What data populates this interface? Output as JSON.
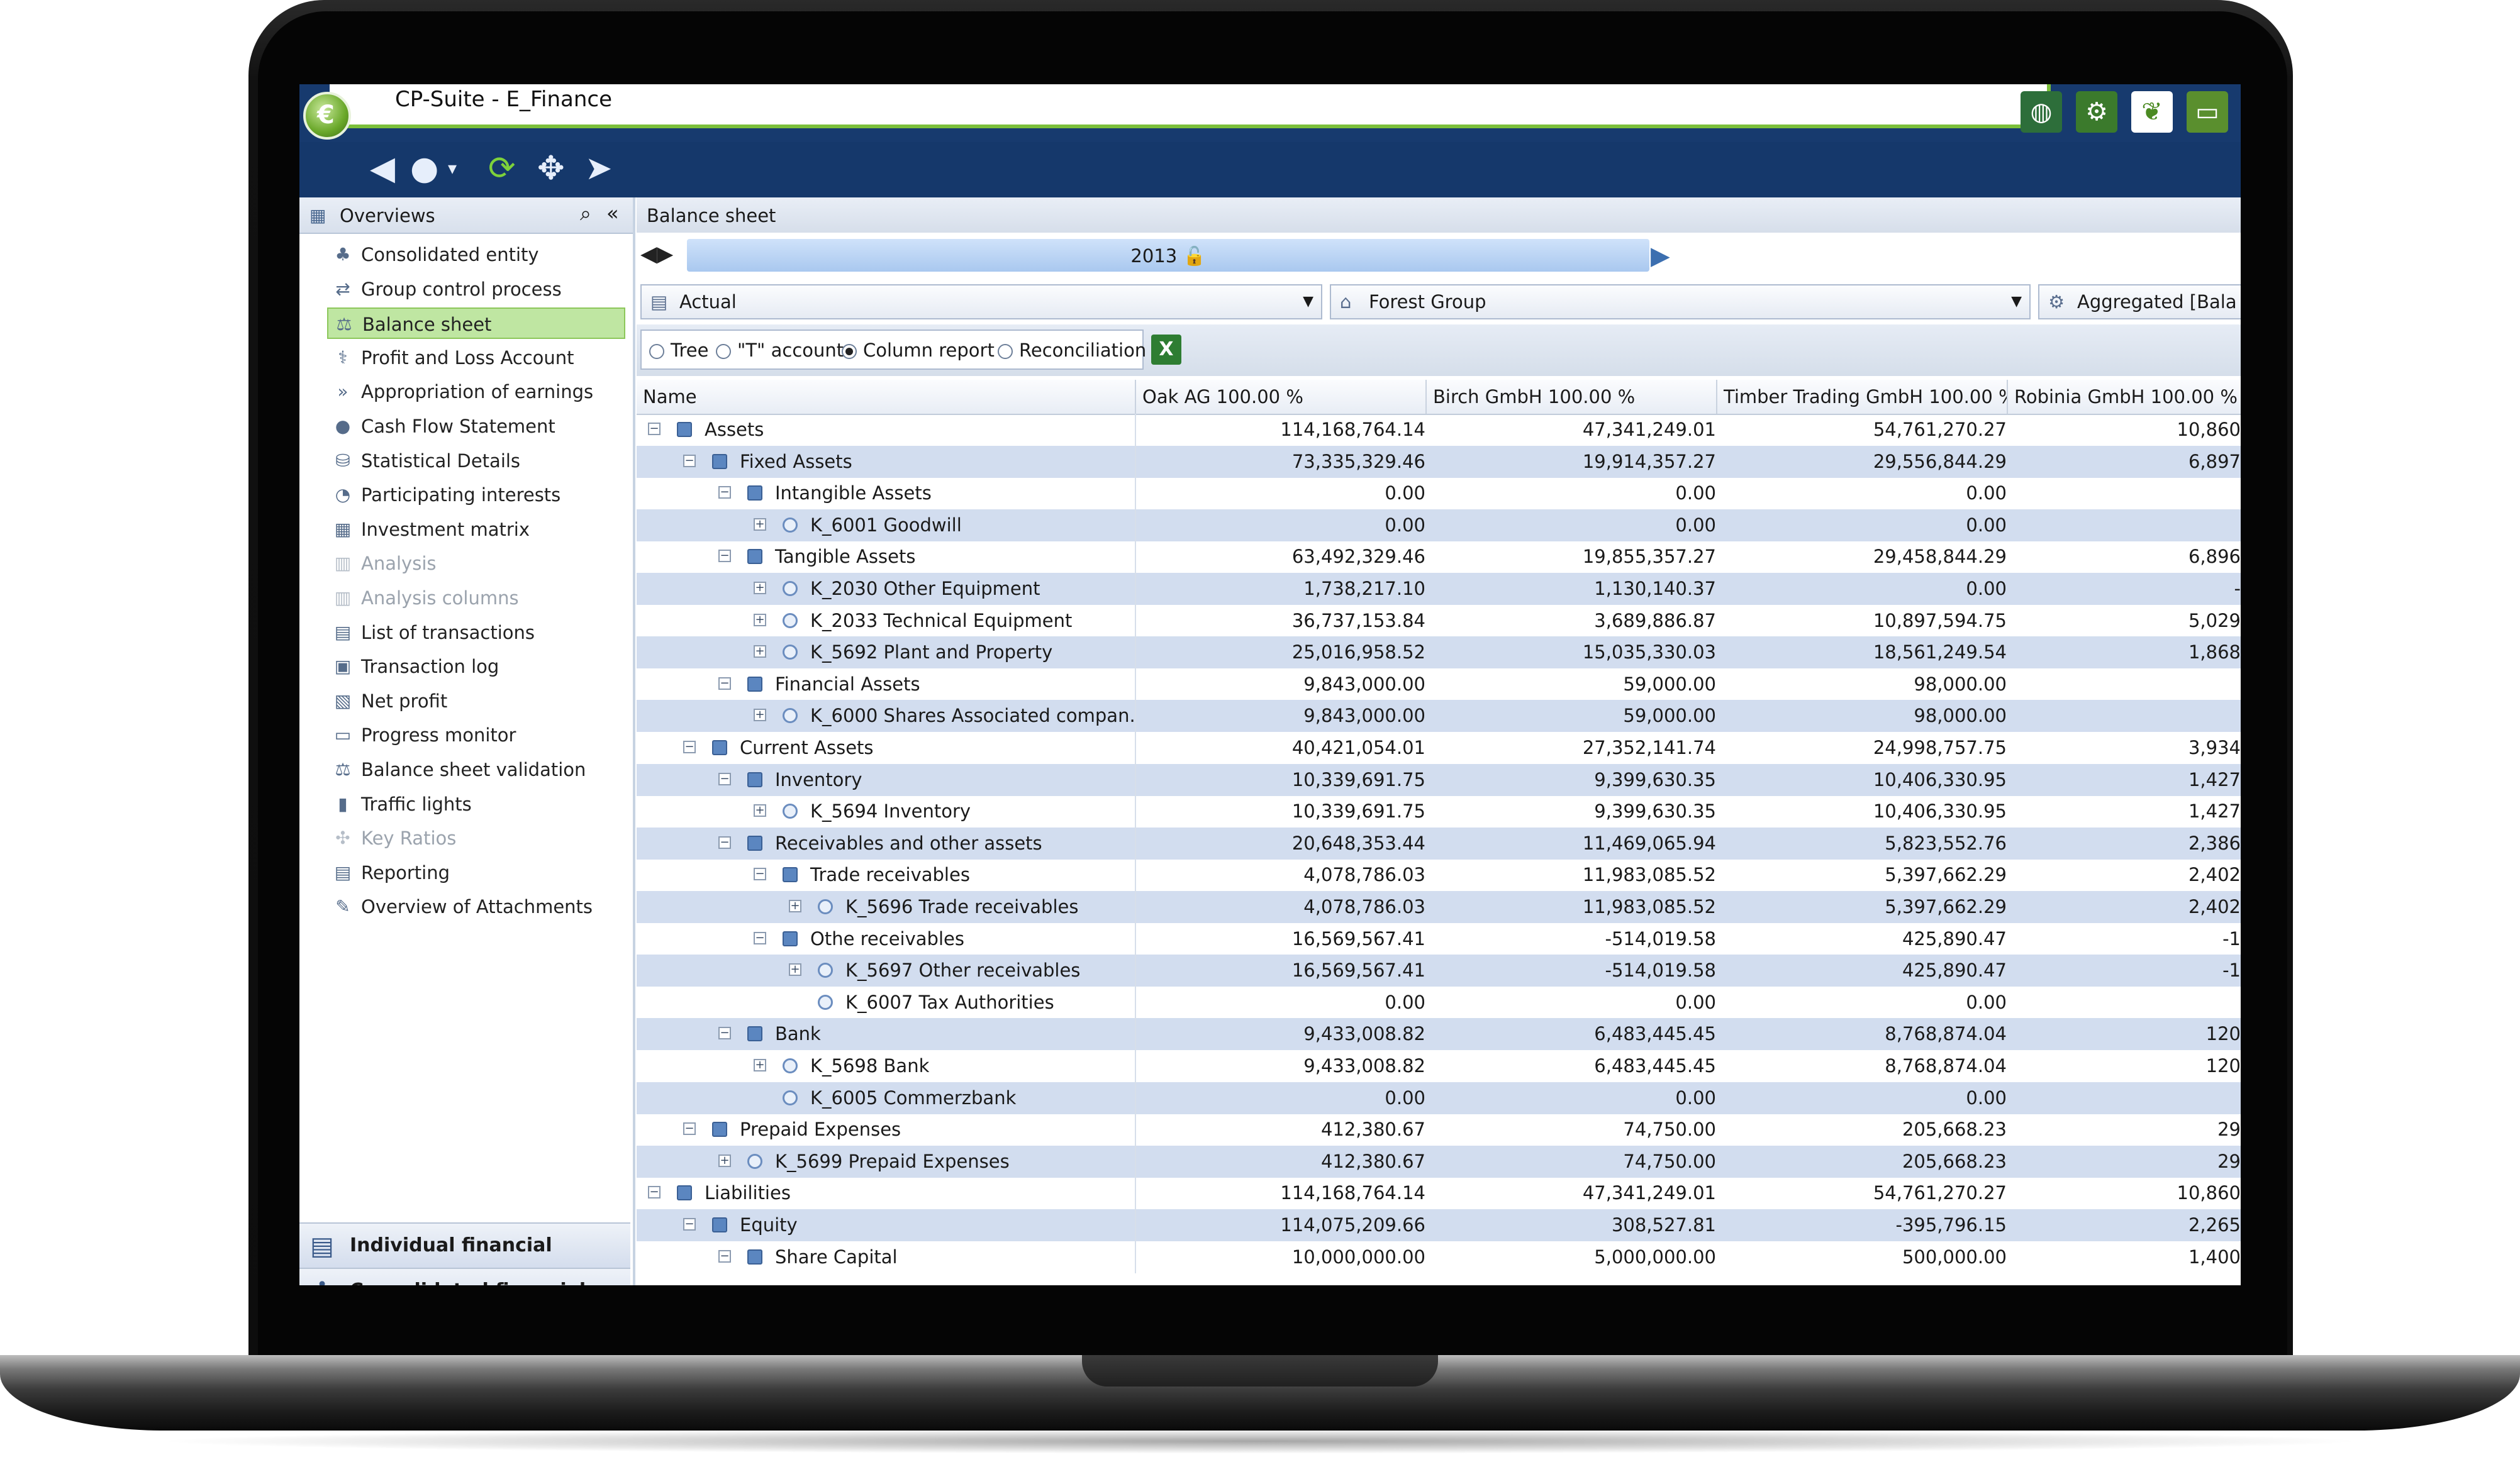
{
  "window": {
    "title": "CP-Suite - E_Finance"
  },
  "toolbar": {
    "icons": [
      "back-arrow-icon",
      "forward-arrow-icon",
      "refresh-icon",
      "move-icon",
      "navigate-icon"
    ]
  },
  "topbar_icons": [
    "globe-icon",
    "gears-icon",
    "leaf-icon",
    "money-icon"
  ],
  "overviews": {
    "title": "Overviews",
    "items": [
      {
        "label": "Consolidated entity",
        "icon": "entity-icon",
        "state": "normal"
      },
      {
        "label": "Group control process",
        "icon": "process-icon",
        "state": "normal"
      },
      {
        "label": "Balance sheet",
        "icon": "scale-icon",
        "state": "selected"
      },
      {
        "label": "Profit and Loss Account",
        "icon": "pl-icon",
        "state": "normal"
      },
      {
        "label": "Appropriation of earnings",
        "icon": "appropriation-icon",
        "state": "normal"
      },
      {
        "label": "Cash Flow Statement",
        "icon": "cashflow-icon",
        "state": "normal"
      },
      {
        "label": "Statistical Details",
        "icon": "statistics-icon",
        "state": "normal"
      },
      {
        "label": "Participating interests",
        "icon": "interests-icon",
        "state": "normal"
      },
      {
        "label": "Investment matrix",
        "icon": "matrix-icon",
        "state": "normal"
      },
      {
        "label": "Analysis",
        "icon": "analysis-icon",
        "state": "disabled"
      },
      {
        "label": "Analysis columns",
        "icon": "analysis-columns-icon",
        "state": "disabled"
      },
      {
        "label": "List of transactions",
        "icon": "list-icon",
        "state": "normal"
      },
      {
        "label": "Transaction log",
        "icon": "log-icon",
        "state": "normal"
      },
      {
        "label": "Net profit",
        "icon": "net-profit-icon",
        "state": "normal"
      },
      {
        "label": "Progress monitor",
        "icon": "monitor-icon",
        "state": "normal"
      },
      {
        "label": "Balance sheet validation",
        "icon": "validation-icon",
        "state": "normal"
      },
      {
        "label": "Traffic lights",
        "icon": "traffic-light-icon",
        "state": "normal"
      },
      {
        "label": "Key Ratios",
        "icon": "ratios-icon",
        "state": "disabled"
      },
      {
        "label": "Reporting",
        "icon": "reporting-icon",
        "state": "normal"
      },
      {
        "label": "Overview of Attachments",
        "icon": "paperclip-icon",
        "state": "normal"
      }
    ],
    "bottom_buttons": [
      {
        "label": "Individual financial stateme...",
        "icon": "document-icon"
      },
      {
        "label": "Consolidated financial state...",
        "icon": "consolidation-icon"
      }
    ]
  },
  "balance_sheet": {
    "title": "Balance sheet",
    "year": "2013",
    "scenario": "Actual",
    "group": "Forest Group",
    "aggregation": "Aggregated [Bala",
    "views": [
      {
        "label": "Tree",
        "selected": false
      },
      {
        "label": "\"T\" account",
        "selected": false
      },
      {
        "label": "Column report",
        "selected": true
      },
      {
        "label": "Reconciliation",
        "selected": false
      }
    ],
    "excel_label": "X",
    "columns": [
      "Name",
      "Oak AG 100.00 %",
      "Birch GmbH 100.00 %",
      "Timber Trading GmbH 100.00 %",
      "Robinia GmbH 100.00 %"
    ],
    "rows": [
      {
        "level": 0,
        "kind": "folder",
        "name": "Assets",
        "v": [
          "114,168,764.14",
          "47,341,249.01",
          "54,761,270.27",
          "10,860"
        ]
      },
      {
        "level": 1,
        "kind": "folder",
        "name": "Fixed Assets",
        "v": [
          "73,335,329.46",
          "19,914,357.27",
          "29,556,844.29",
          "6,897"
        ]
      },
      {
        "level": 2,
        "kind": "folder",
        "name": "Intangible Assets",
        "v": [
          "0.00",
          "0.00",
          "0.00",
          ""
        ]
      },
      {
        "level": 3,
        "kind": "account",
        "name": "K_6001  Goodwill",
        "v": [
          "0.00",
          "0.00",
          "0.00",
          ""
        ]
      },
      {
        "level": 2,
        "kind": "folder",
        "name": "Tangible Assets",
        "v": [
          "63,492,329.46",
          "19,855,357.27",
          "29,458,844.29",
          "6,896"
        ]
      },
      {
        "level": 3,
        "kind": "account",
        "name": "K_2030  Other Equipment",
        "v": [
          "1,738,217.10",
          "1,130,140.37",
          "0.00",
          "-"
        ]
      },
      {
        "level": 3,
        "kind": "account",
        "name": "K_2033  Technical Equipment",
        "v": [
          "36,737,153.84",
          "3,689,886.87",
          "10,897,594.75",
          "5,029"
        ]
      },
      {
        "level": 3,
        "kind": "account",
        "name": "K_5692  Plant and Property",
        "v": [
          "25,016,958.52",
          "15,035,330.03",
          "18,561,249.54",
          "1,868"
        ]
      },
      {
        "level": 2,
        "kind": "folder",
        "name": "Financial Assets",
        "v": [
          "9,843,000.00",
          "59,000.00",
          "98,000.00",
          ""
        ]
      },
      {
        "level": 3,
        "kind": "account",
        "name": "K_6000  Shares Associated compan...",
        "v": [
          "9,843,000.00",
          "59,000.00",
          "98,000.00",
          ""
        ]
      },
      {
        "level": 1,
        "kind": "folder",
        "name": "Current Assets",
        "v": [
          "40,421,054.01",
          "27,352,141.74",
          "24,998,757.75",
          "3,934"
        ]
      },
      {
        "level": 2,
        "kind": "folder",
        "name": "Inventory",
        "v": [
          "10,339,691.75",
          "9,399,630.35",
          "10,406,330.95",
          "1,427"
        ]
      },
      {
        "level": 3,
        "kind": "account",
        "name": "K_5694  Inventory",
        "v": [
          "10,339,691.75",
          "9,399,630.35",
          "10,406,330.95",
          "1,427"
        ]
      },
      {
        "level": 2,
        "kind": "folder",
        "name": "Receivables and other assets",
        "v": [
          "20,648,353.44",
          "11,469,065.94",
          "5,823,552.76",
          "2,386"
        ]
      },
      {
        "level": 3,
        "kind": "folder",
        "name": "Trade receivables",
        "v": [
          "4,078,786.03",
          "11,983,085.52",
          "5,397,662.29",
          "2,402"
        ]
      },
      {
        "level": 4,
        "kind": "account",
        "name": "K_5696  Trade receivables",
        "v": [
          "4,078,786.03",
          "11,983,085.52",
          "5,397,662.29",
          "2,402"
        ]
      },
      {
        "level": 3,
        "kind": "folder",
        "name": "Othe receivables",
        "v": [
          "16,569,567.41",
          "-514,019.58",
          "425,890.47",
          "-1"
        ]
      },
      {
        "level": 4,
        "kind": "account",
        "name": "K_5697  Other receivables",
        "v": [
          "16,569,567.41",
          "-514,019.58",
          "425,890.47",
          "-1"
        ]
      },
      {
        "level": 4,
        "kind": "leaf",
        "name": "K_6007  Tax Authorities",
        "v": [
          "0.00",
          "0.00",
          "0.00",
          ""
        ]
      },
      {
        "level": 2,
        "kind": "folder",
        "name": "Bank",
        "v": [
          "9,433,008.82",
          "6,483,445.45",
          "8,768,874.04",
          "120"
        ]
      },
      {
        "level": 3,
        "kind": "account",
        "name": "K_5698  Bank",
        "v": [
          "9,433,008.82",
          "6,483,445.45",
          "8,768,874.04",
          "120"
        ]
      },
      {
        "level": 3,
        "kind": "leaf",
        "name": "K_6005  Commerzbank",
        "v": [
          "0.00",
          "0.00",
          "0.00",
          ""
        ]
      },
      {
        "level": 1,
        "kind": "folder",
        "name": "Prepaid Expenses",
        "v": [
          "412,380.67",
          "74,750.00",
          "205,668.23",
          "29"
        ]
      },
      {
        "level": 2,
        "kind": "account",
        "name": "K_5699  Prepaid Expenses",
        "v": [
          "412,380.67",
          "74,750.00",
          "205,668.23",
          "29"
        ]
      },
      {
        "level": 0,
        "kind": "folder",
        "name": "Liabilities",
        "v": [
          "114,168,764.14",
          "47,341,249.01",
          "54,761,270.27",
          "10,860"
        ]
      },
      {
        "level": 1,
        "kind": "folder",
        "name": "Equity",
        "v": [
          "114,075,209.66",
          "308,527.81",
          "-395,796.15",
          "2,265"
        ]
      },
      {
        "level": 2,
        "kind": "folder",
        "name": "Share Capital",
        "v": [
          "10,000,000.00",
          "5,000,000.00",
          "500,000.00",
          "1,400"
        ]
      }
    ]
  }
}
